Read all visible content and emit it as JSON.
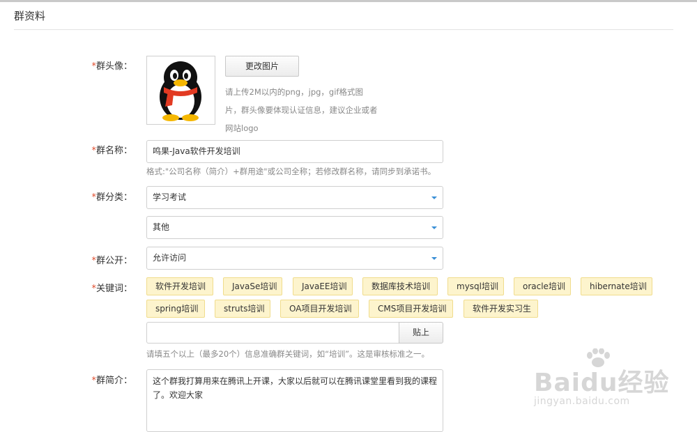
{
  "page_title": "群资料",
  "form": {
    "required_mark": "*",
    "avatar": {
      "label": "群头像：",
      "change_button": "更改图片",
      "hint": "请上传2M以内的png，jpg，gif格式图片，群头像要体现认证信息，建议企业或者网站logo"
    },
    "name": {
      "label": "群名称：",
      "value": "鸣果-Java软件开发培训",
      "hint": "格式:\"公司名称（简介）+群用途\"或公司全称；若修改群名称，请同步到承诺书。"
    },
    "category": {
      "label": "群分类：",
      "primary_value": "学习考试",
      "secondary_value": "其他"
    },
    "visibility": {
      "label": "群公开：",
      "value": "允许访问"
    },
    "keywords": {
      "label": "关键词：",
      "tags": [
        "软件开发培训",
        "JavaSe培训",
        "JavaEE培训",
        "数据库技术培训",
        "mysql培训",
        "oracle培训",
        "hibernate培训",
        "spring培训",
        "struts培训",
        "OA项目开发培训",
        "CMS项目开发培训",
        "软件开发实习生"
      ],
      "input_value": "",
      "paste_button": "贴上",
      "hint": "请填五个以上（最多20个）信息准确群关键词，如“培训”。这是审核标准之一。"
    },
    "intro": {
      "label": "群简介：",
      "value": "这个群我打算用来在腾讯上开课，大家以后就可以在腾讯课堂里看到我的课程了。欢迎大家"
    }
  },
  "watermark": {
    "brand": "Baidu经验",
    "url": "jingyan.baidu.com"
  },
  "colors": {
    "required": "#e04b2b",
    "tag_bg": "#fdf4cd",
    "tag_border": "#f0dc8c",
    "caret": "#3a8fd6"
  }
}
